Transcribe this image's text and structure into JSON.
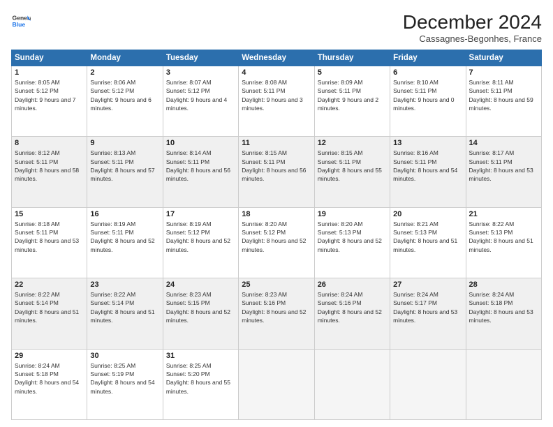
{
  "logo": {
    "general": "General",
    "blue": "Blue"
  },
  "header": {
    "month_year": "December 2024",
    "location": "Cassagnes-Begonhes, France"
  },
  "weekdays": [
    "Sunday",
    "Monday",
    "Tuesday",
    "Wednesday",
    "Thursday",
    "Friday",
    "Saturday"
  ],
  "weeks": [
    [
      {
        "day": "1",
        "sunrise": "8:05 AM",
        "sunset": "5:12 PM",
        "daylight": "9 hours and 7 minutes."
      },
      {
        "day": "2",
        "sunrise": "8:06 AM",
        "sunset": "5:12 PM",
        "daylight": "9 hours and 6 minutes."
      },
      {
        "day": "3",
        "sunrise": "8:07 AM",
        "sunset": "5:12 PM",
        "daylight": "9 hours and 4 minutes."
      },
      {
        "day": "4",
        "sunrise": "8:08 AM",
        "sunset": "5:11 PM",
        "daylight": "9 hours and 3 minutes."
      },
      {
        "day": "5",
        "sunrise": "8:09 AM",
        "sunset": "5:11 PM",
        "daylight": "9 hours and 2 minutes."
      },
      {
        "day": "6",
        "sunrise": "8:10 AM",
        "sunset": "5:11 PM",
        "daylight": "9 hours and 0 minutes."
      },
      {
        "day": "7",
        "sunrise": "8:11 AM",
        "sunset": "5:11 PM",
        "daylight": "8 hours and 59 minutes."
      }
    ],
    [
      {
        "day": "8",
        "sunrise": "8:12 AM",
        "sunset": "5:11 PM",
        "daylight": "8 hours and 58 minutes."
      },
      {
        "day": "9",
        "sunrise": "8:13 AM",
        "sunset": "5:11 PM",
        "daylight": "8 hours and 57 minutes."
      },
      {
        "day": "10",
        "sunrise": "8:14 AM",
        "sunset": "5:11 PM",
        "daylight": "8 hours and 56 minutes."
      },
      {
        "day": "11",
        "sunrise": "8:15 AM",
        "sunset": "5:11 PM",
        "daylight": "8 hours and 56 minutes."
      },
      {
        "day": "12",
        "sunrise": "8:15 AM",
        "sunset": "5:11 PM",
        "daylight": "8 hours and 55 minutes."
      },
      {
        "day": "13",
        "sunrise": "8:16 AM",
        "sunset": "5:11 PM",
        "daylight": "8 hours and 54 minutes."
      },
      {
        "day": "14",
        "sunrise": "8:17 AM",
        "sunset": "5:11 PM",
        "daylight": "8 hours and 53 minutes."
      }
    ],
    [
      {
        "day": "15",
        "sunrise": "8:18 AM",
        "sunset": "5:11 PM",
        "daylight": "8 hours and 53 minutes."
      },
      {
        "day": "16",
        "sunrise": "8:19 AM",
        "sunset": "5:11 PM",
        "daylight": "8 hours and 52 minutes."
      },
      {
        "day": "17",
        "sunrise": "8:19 AM",
        "sunset": "5:12 PM",
        "daylight": "8 hours and 52 minutes."
      },
      {
        "day": "18",
        "sunrise": "8:20 AM",
        "sunset": "5:12 PM",
        "daylight": "8 hours and 52 minutes."
      },
      {
        "day": "19",
        "sunrise": "8:20 AM",
        "sunset": "5:13 PM",
        "daylight": "8 hours and 52 minutes."
      },
      {
        "day": "20",
        "sunrise": "8:21 AM",
        "sunset": "5:13 PM",
        "daylight": "8 hours and 51 minutes."
      },
      {
        "day": "21",
        "sunrise": "8:22 AM",
        "sunset": "5:13 PM",
        "daylight": "8 hours and 51 minutes."
      }
    ],
    [
      {
        "day": "22",
        "sunrise": "8:22 AM",
        "sunset": "5:14 PM",
        "daylight": "8 hours and 51 minutes."
      },
      {
        "day": "23",
        "sunrise": "8:22 AM",
        "sunset": "5:14 PM",
        "daylight": "8 hours and 51 minutes."
      },
      {
        "day": "24",
        "sunrise": "8:23 AM",
        "sunset": "5:15 PM",
        "daylight": "8 hours and 52 minutes."
      },
      {
        "day": "25",
        "sunrise": "8:23 AM",
        "sunset": "5:16 PM",
        "daylight": "8 hours and 52 minutes."
      },
      {
        "day": "26",
        "sunrise": "8:24 AM",
        "sunset": "5:16 PM",
        "daylight": "8 hours and 52 minutes."
      },
      {
        "day": "27",
        "sunrise": "8:24 AM",
        "sunset": "5:17 PM",
        "daylight": "8 hours and 53 minutes."
      },
      {
        "day": "28",
        "sunrise": "8:24 AM",
        "sunset": "5:18 PM",
        "daylight": "8 hours and 53 minutes."
      }
    ],
    [
      {
        "day": "29",
        "sunrise": "8:24 AM",
        "sunset": "5:18 PM",
        "daylight": "8 hours and 54 minutes."
      },
      {
        "day": "30",
        "sunrise": "8:25 AM",
        "sunset": "5:19 PM",
        "daylight": "8 hours and 54 minutes."
      },
      {
        "day": "31",
        "sunrise": "8:25 AM",
        "sunset": "5:20 PM",
        "daylight": "8 hours and 55 minutes."
      },
      null,
      null,
      null,
      null
    ]
  ],
  "labels": {
    "sunrise": "Sunrise:",
    "sunset": "Sunset:",
    "daylight": "Daylight:"
  }
}
